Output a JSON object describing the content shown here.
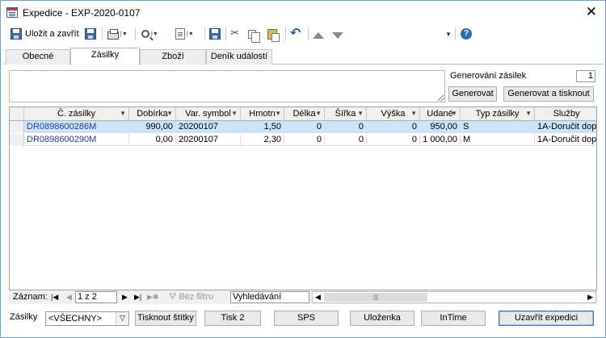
{
  "window": {
    "title": "Expedice - EXP-2020-0107"
  },
  "toolbar": {
    "save_close": "Uložit a zavřít"
  },
  "tabs": [
    {
      "label": "Obecné"
    },
    {
      "label": "Zásilky"
    },
    {
      "label": "Zboží"
    },
    {
      "label": "Deník událostí"
    }
  ],
  "generate": {
    "label": "Generování zásilek",
    "count": "1",
    "generate_btn": "Generovat",
    "generate_print_btn": "Generovat a tisknout"
  },
  "grid": {
    "columns": [
      "Č. zásilky",
      "Dobírka",
      "Var. symbol",
      "Hmotn",
      "Délka",
      "Šířka",
      "Výška",
      "Udané",
      "Typ zásilky",
      "Služby"
    ],
    "rows": [
      {
        "cislo": "DR0898600286M",
        "dobirka": "990,00",
        "vs": "20200107",
        "hmotnost": "1,50",
        "delka": "0",
        "sirka": "0",
        "vyska": "0",
        "udane": "950,00",
        "typ": "S",
        "sluzby": "1A-Doručit dop"
      },
      {
        "cislo": "DR0898600290M",
        "dobirka": "0,00",
        "vs": "20200107",
        "hmotnost": "2,30",
        "delka": "0",
        "sirka": "0",
        "vyska": "0",
        "udane": "1 000,00",
        "typ": "M",
        "sluzby": "1A-Doručit dop"
      }
    ]
  },
  "navigator": {
    "label": "Záznam:",
    "position": "1 z 2",
    "filter": "Bez filtru",
    "search": "Vyhledávání"
  },
  "footer": {
    "label": "Zásilky",
    "filter_value": "<VŠECHNY>",
    "buttons": [
      "Tisknout štítky",
      "Tisk 2",
      "SPS",
      "Uloženka",
      "InTime",
      "Uzavřít expedici"
    ]
  }
}
